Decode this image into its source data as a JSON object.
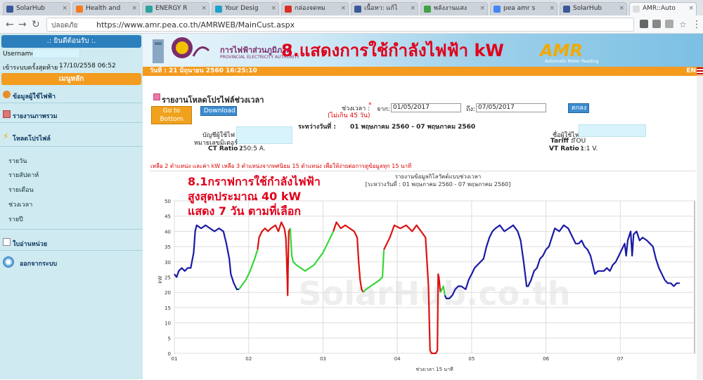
{
  "browser": {
    "tabs": [
      {
        "label": "SolarHub",
        "fav": "#3b5998",
        "active": false
      },
      {
        "label": "Health and",
        "fav": "#f47b20",
        "active": false
      },
      {
        "label": "ENERGY R",
        "fav": "#2aa3a0",
        "active": false
      },
      {
        "label": "Your Desig",
        "fav": "#1fa2c8",
        "active": false
      },
      {
        "label": "กล่องจดหม",
        "fav": "#d93025",
        "active": false
      },
      {
        "label": "เนื้อหา: แก้ไ",
        "fav": "#3b5998",
        "active": false
      },
      {
        "label": "พลังงานแสง",
        "fav": "#43a047",
        "active": false
      },
      {
        "label": "pea amr s",
        "fav": "#4285f4",
        "active": false
      },
      {
        "label": "SolarHub",
        "fav": "#3b5998",
        "active": false
      },
      {
        "label": "AMR::Auto",
        "fav": "#dddddd",
        "active": true
      }
    ],
    "secure_label": "ปลอดภัย",
    "url": "https://www.amr.pea.co.th/AMRWEB/MainCust.aspx"
  },
  "sidebar": {
    "welcome": ".: ยินดีต้อนรับ :.",
    "username_label": "Username :",
    "last_login_label": "เข้าระบบครั้งสุดท้าย :",
    "last_login_value": "17/10/2558 06:52",
    "main_menu": "เมนูหลัก",
    "menu": [
      {
        "label": "ข้อมูลผู้ใช้ไฟฟ้า",
        "icon": "user-icon"
      },
      {
        "label": "รายงานภาพรวม",
        "icon": "report-icon"
      },
      {
        "label": "โหลดโปรไฟล์",
        "icon": "bolt-icon"
      }
    ],
    "sub_items": [
      "รายวัน",
      "รายสัปดาห์",
      "รายเดือน",
      "ช่วงเวลา",
      "รายปี"
    ],
    "bill": "ใบอ่านหน่วย",
    "logout": "ออกจากระบบ"
  },
  "banner": {
    "org_name": "การไฟฟ้าส่วนภูมิภาค",
    "org_en": "PROVINCIAL ELECTRICITY AUTHORITY",
    "amr_logo": "AMR",
    "amr_sub": "Automatic Meter Reading",
    "annotation": "8.แสดงการใช้กำลังไฟฟ้า kW"
  },
  "datestrip": {
    "text": "วันที่ :  21 มิถุนายน 2560  16:25:10",
    "lang": "EN"
  },
  "report": {
    "title": "รายงานโหลดโปรไฟล์ช่วงเวลา",
    "goto_bottom": "Go to Bottom",
    "download": "Download",
    "range_label": "ช่วงเวลา :",
    "required_mark": "*",
    "from_label": "จาก:",
    "from_value": "01/05/2017",
    "to_label": "ถึง:",
    "to_value": "07/05/2017",
    "limit_note": "(ไม่เกิน 45 วัน)",
    "ok": "ตกลง",
    "between_label": "ระหว่างวันที่ :",
    "between_value": "01 พฤษภาคม 2560 - 07 พฤษภาคม 2560",
    "account_label": "บัญชีผู้ใช้ไฟ",
    "meter_label": "หมายเลขมิเตอร์",
    "ct_label": "CT Ratio :",
    "ct_value": "250:5 A.",
    "user_label": "ชื่อผู้ใช้ไฟ",
    "tariff_label": "Tariff :",
    "tariff_value": "TOU",
    "vt_label": "VT Ratio :",
    "vt_value": "1:1 V.",
    "warning": "เหลือ 2 ตำแหน่ง และค่า kW เหลือ 3 ตำแหน่งจากทศนิยม 15 ตำแหน่ง เพื่อให้ง่ายต่อการดูข้อมูลทุก 15 นาที"
  },
  "annotation_81": {
    "line1": "8.1กราฟการใช้กำลังไฟฟ้า",
    "line2": "สูงสุดประมาณ 40 kW",
    "line3": "แสดง 7 วัน ตามที่เลือก"
  },
  "chart_data": {
    "type": "line",
    "title": "รายงานข้อมูลกิโลวัตต์แบบช่วงเวลา",
    "subtitle": "[ระหว่างวันที่ : 01 พฤษภาคม 2560 - 07 พฤษภาคม 2560]",
    "xlabel": "ช่วงเวลา 15 นาที",
    "ylabel": "kW",
    "ylim": [
      0,
      50
    ],
    "xlim": [
      1,
      8
    ],
    "y_ticks": [
      0,
      5,
      10,
      15,
      20,
      25,
      30,
      35,
      40,
      45,
      50
    ],
    "x_ticks": [
      "01",
      "02",
      "03",
      "04",
      "05",
      "06",
      "07"
    ],
    "watermark": "SolarHub.co.th",
    "grid": true,
    "colors": {
      "blue": "#1a1aa6",
      "green": "#35d63a",
      "red": "#dd1111"
    },
    "series": [
      {
        "color_key": "blue",
        "points": [
          [
            1.0,
            26
          ],
          [
            1.03,
            25
          ],
          [
            1.06,
            27
          ],
          [
            1.1,
            28
          ],
          [
            1.14,
            27
          ],
          [
            1.18,
            28
          ],
          [
            1.22,
            28
          ],
          [
            1.26,
            33
          ],
          [
            1.28,
            40
          ],
          [
            1.3,
            42
          ],
          [
            1.36,
            41
          ],
          [
            1.42,
            42
          ],
          [
            1.48,
            41
          ],
          [
            1.54,
            40
          ],
          [
            1.6,
            41
          ],
          [
            1.66,
            40
          ],
          [
            1.7,
            36
          ],
          [
            1.74,
            31
          ],
          [
            1.76,
            26
          ],
          [
            1.8,
            23
          ],
          [
            1.84,
            21
          ],
          [
            1.87,
            21
          ]
        ]
      },
      {
        "color_key": "green",
        "points": [
          [
            1.87,
            21
          ],
          [
            1.9,
            22
          ],
          [
            1.96,
            24
          ],
          [
            2.02,
            27
          ],
          [
            2.08,
            31
          ],
          [
            2.12,
            34
          ]
        ]
      },
      {
        "color_key": "red",
        "points": [
          [
            2.12,
            34
          ],
          [
            2.14,
            38
          ],
          [
            2.18,
            40
          ],
          [
            2.22,
            41
          ],
          [
            2.26,
            40
          ],
          [
            2.3,
            41
          ],
          [
            2.36,
            42
          ],
          [
            2.4,
            40
          ],
          [
            2.44,
            43
          ],
          [
            2.48,
            41
          ],
          [
            2.5,
            38
          ],
          [
            2.51,
            32
          ],
          [
            2.52,
            24
          ],
          [
            2.525,
            19
          ],
          [
            2.53,
            27
          ],
          [
            2.54,
            40
          ],
          [
            2.56,
            41
          ]
        ]
      },
      {
        "color_key": "green",
        "points": [
          [
            2.56,
            41
          ],
          [
            2.58,
            32
          ],
          [
            2.6,
            30
          ],
          [
            2.64,
            29
          ],
          [
            2.7,
            28
          ],
          [
            2.76,
            27
          ],
          [
            2.82,
            28
          ],
          [
            2.88,
            29
          ],
          [
            2.94,
            31
          ],
          [
            3.0,
            33
          ],
          [
            3.06,
            36
          ],
          [
            3.1,
            38
          ],
          [
            3.14,
            40
          ]
        ]
      },
      {
        "color_key": "red",
        "points": [
          [
            3.14,
            40
          ],
          [
            3.18,
            43
          ],
          [
            3.24,
            41
          ],
          [
            3.3,
            42
          ],
          [
            3.36,
            41
          ],
          [
            3.42,
            40
          ],
          [
            3.46,
            38
          ],
          [
            3.48,
            30
          ],
          [
            3.5,
            24
          ],
          [
            3.52,
            21
          ],
          [
            3.54,
            20
          ]
        ]
      },
      {
        "color_key": "green",
        "points": [
          [
            3.54,
            20
          ],
          [
            3.58,
            21
          ],
          [
            3.64,
            22
          ],
          [
            3.7,
            23
          ],
          [
            3.76,
            24
          ],
          [
            3.8,
            25
          ],
          [
            3.82,
            34
          ]
        ]
      },
      {
        "color_key": "red",
        "points": [
          [
            3.82,
            34
          ],
          [
            3.86,
            36
          ],
          [
            3.9,
            38
          ],
          [
            3.96,
            42
          ],
          [
            4.04,
            41
          ],
          [
            4.12,
            42
          ],
          [
            4.2,
            40
          ],
          [
            4.26,
            42
          ],
          [
            4.32,
            40
          ],
          [
            4.38,
            38
          ],
          [
            4.4,
            30
          ],
          [
            4.42,
            22
          ],
          [
            4.44,
            1
          ],
          [
            4.46,
            0
          ],
          [
            4.52,
            0
          ],
          [
            4.54,
            1
          ],
          [
            4.55,
            26
          ],
          [
            4.56,
            25
          ],
          [
            4.58,
            20
          ]
        ]
      },
      {
        "color_key": "green",
        "points": [
          [
            4.58,
            20
          ],
          [
            4.6,
            21
          ],
          [
            4.62,
            22
          ],
          [
            4.64,
            19
          ]
        ]
      },
      {
        "color_key": "blue",
        "points": [
          [
            4.64,
            19
          ],
          [
            4.66,
            18
          ],
          [
            4.7,
            18
          ],
          [
            4.74,
            19
          ],
          [
            4.78,
            21
          ],
          [
            4.82,
            22
          ],
          [
            4.86,
            22
          ],
          [
            4.92,
            21
          ],
          [
            4.96,
            24
          ],
          [
            5.0,
            26
          ],
          [
            5.04,
            28
          ],
          [
            5.08,
            29
          ],
          [
            5.12,
            30
          ],
          [
            5.16,
            31
          ],
          [
            5.2,
            35
          ],
          [
            5.24,
            38
          ],
          [
            5.28,
            40
          ],
          [
            5.32,
            41
          ],
          [
            5.38,
            42
          ],
          [
            5.44,
            40
          ],
          [
            5.5,
            41
          ],
          [
            5.56,
            42
          ],
          [
            5.62,
            40
          ],
          [
            5.66,
            37
          ],
          [
            5.7,
            30
          ],
          [
            5.74,
            22
          ],
          [
            5.76,
            22
          ],
          [
            5.8,
            24
          ],
          [
            5.84,
            27
          ],
          [
            5.88,
            28
          ],
          [
            5.92,
            31
          ],
          [
            5.96,
            32
          ],
          [
            6.0,
            34
          ],
          [
            6.04,
            35
          ],
          [
            6.08,
            38
          ],
          [
            6.12,
            41
          ],
          [
            6.18,
            40
          ],
          [
            6.24,
            42
          ],
          [
            6.3,
            41
          ],
          [
            6.36,
            38
          ],
          [
            6.4,
            36
          ],
          [
            6.44,
            36
          ],
          [
            6.48,
            37
          ],
          [
            6.52,
            35
          ],
          [
            6.56,
            34
          ],
          [
            6.6,
            32
          ],
          [
            6.64,
            28
          ],
          [
            6.66,
            26
          ],
          [
            6.7,
            27
          ],
          [
            6.74,
            27
          ],
          [
            6.78,
            27
          ],
          [
            6.82,
            28
          ],
          [
            6.86,
            27
          ],
          [
            6.9,
            29
          ],
          [
            6.94,
            30
          ],
          [
            6.98,
            32
          ],
          [
            7.02,
            34
          ],
          [
            7.06,
            36
          ],
          [
            7.08,
            32
          ],
          [
            7.1,
            37
          ],
          [
            7.14,
            40
          ],
          [
            7.16,
            32
          ],
          [
            7.18,
            39
          ],
          [
            7.22,
            40
          ],
          [
            7.26,
            37
          ],
          [
            7.3,
            38
          ],
          [
            7.36,
            37
          ],
          [
            7.4,
            36
          ],
          [
            7.44,
            35
          ],
          [
            7.48,
            31
          ],
          [
            7.52,
            28
          ],
          [
            7.56,
            26
          ],
          [
            7.6,
            24
          ],
          [
            7.64,
            23
          ],
          [
            7.68,
            23
          ],
          [
            7.72,
            22
          ],
          [
            7.76,
            23
          ],
          [
            7.8,
            23
          ]
        ]
      }
    ]
  }
}
